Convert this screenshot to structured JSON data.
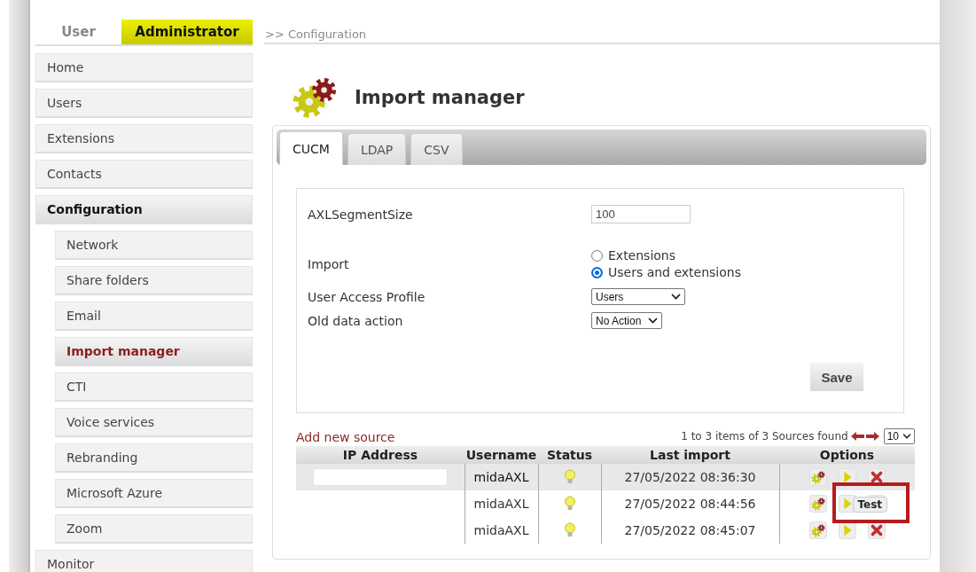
{
  "role_tabs": [
    {
      "label": "User",
      "selected": false
    },
    {
      "label": "Administrator",
      "selected": true
    }
  ],
  "breadcrumb": ">> Configuration",
  "sidebar": {
    "items": [
      {
        "label": "Home",
        "selected": false
      },
      {
        "label": "Users",
        "selected": false
      },
      {
        "label": "Extensions",
        "selected": false
      },
      {
        "label": "Contacts",
        "selected": false
      },
      {
        "label": "Configuration",
        "selected": true,
        "children": [
          {
            "label": "Network",
            "selected": false
          },
          {
            "label": "Share folders",
            "selected": false
          },
          {
            "label": "Email",
            "selected": false
          },
          {
            "label": "Import manager",
            "selected": true
          },
          {
            "label": "CTI",
            "selected": false
          },
          {
            "label": "Voice services",
            "selected": false
          },
          {
            "label": "Rebranding",
            "selected": false
          },
          {
            "label": "Microsoft Azure",
            "selected": false
          },
          {
            "label": "Zoom",
            "selected": false
          }
        ]
      },
      {
        "label": "Monitor",
        "selected": false
      }
    ]
  },
  "page_title": "Import manager",
  "tabs": [
    {
      "label": "CUCM",
      "selected": true
    },
    {
      "label": "LDAP",
      "selected": false
    },
    {
      "label": "CSV",
      "selected": false
    }
  ],
  "form": {
    "fields": [
      {
        "kind": "text",
        "label": "AXLSegmentSize",
        "value": "100"
      },
      {
        "kind": "radio",
        "label": "Import",
        "options": [
          {
            "label": "Extensions",
            "selected": false
          },
          {
            "label": "Users and extensions",
            "selected": true
          }
        ]
      },
      {
        "kind": "select",
        "label": "User Access Profile",
        "value": "Users"
      },
      {
        "kind": "select",
        "label": "Old data action",
        "value": "No Action"
      }
    ],
    "save_button": "Save"
  },
  "sources": {
    "add_link": "Add new source",
    "summary": "1 to 3 items of 3 Sources found",
    "page_size": "10",
    "columns": [
      "IP Address",
      "Username",
      "Status",
      "Last import",
      "Options"
    ],
    "rows": [
      {
        "username": "midaAXL",
        "last_import": "27/05/2022 08:36:30",
        "selected": true,
        "ip_redacted": true,
        "highlighted": false
      },
      {
        "username": "midaAXL",
        "last_import": "27/05/2022 08:44:56",
        "selected": false,
        "ip_redacted": false,
        "highlighted": true,
        "tooltip": "Test"
      },
      {
        "username": "midaAXL",
        "last_import": "27/05/2022 08:45:07",
        "selected": false,
        "ip_redacted": false,
        "highlighted": false
      }
    ]
  }
}
